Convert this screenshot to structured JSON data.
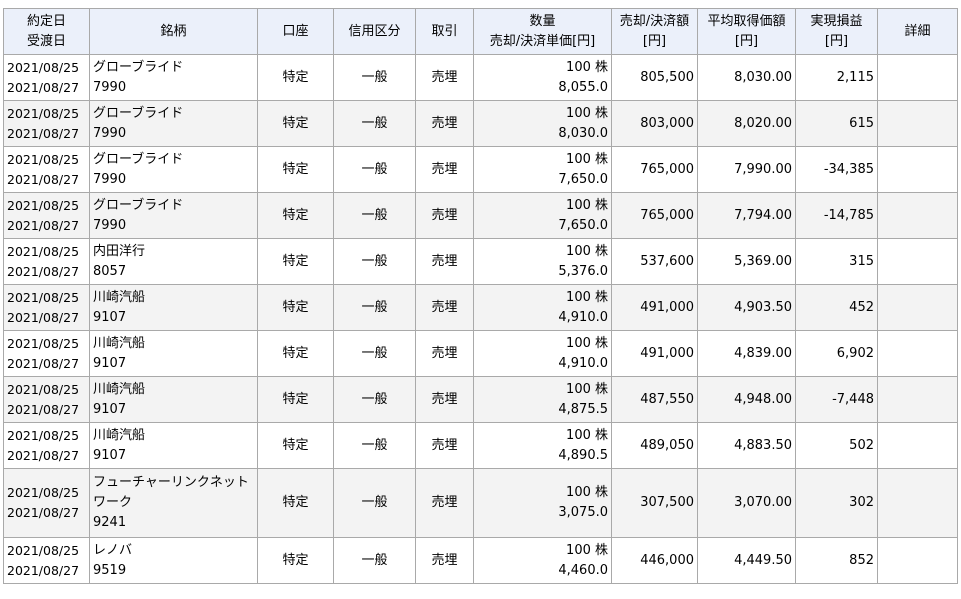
{
  "headers": {
    "date": [
      "約定日",
      "受渡日"
    ],
    "name": "銘柄",
    "account": "口座",
    "credit": "信用区分",
    "trade": "取引",
    "qty": [
      "数量",
      "売却/決済単価[円]"
    ],
    "amount": [
      "売却/決済額",
      "[円]"
    ],
    "avg": [
      "平均取得価額",
      "[円]"
    ],
    "pl": [
      "実現損益",
      "[円]"
    ],
    "detail": "詳細"
  },
  "rows": [
    {
      "trade_date": "2021/08/25",
      "settle_date": "2021/08/27",
      "name": "グローブライド",
      "code": "7990",
      "account": "特定",
      "credit": "一般",
      "trade": "売埋",
      "qty": "100 株",
      "unit_price": "8,055.0",
      "amount": "805,500",
      "avg_cost": "8,030.00",
      "pl": "2,115"
    },
    {
      "trade_date": "2021/08/25",
      "settle_date": "2021/08/27",
      "name": "グローブライド",
      "code": "7990",
      "account": "特定",
      "credit": "一般",
      "trade": "売埋",
      "qty": "100 株",
      "unit_price": "8,030.0",
      "amount": "803,000",
      "avg_cost": "8,020.00",
      "pl": "615"
    },
    {
      "trade_date": "2021/08/25",
      "settle_date": "2021/08/27",
      "name": "グローブライド",
      "code": "7990",
      "account": "特定",
      "credit": "一般",
      "trade": "売埋",
      "qty": "100 株",
      "unit_price": "7,650.0",
      "amount": "765,000",
      "avg_cost": "7,990.00",
      "pl": "-34,385"
    },
    {
      "trade_date": "2021/08/25",
      "settle_date": "2021/08/27",
      "name": "グローブライド",
      "code": "7990",
      "account": "特定",
      "credit": "一般",
      "trade": "売埋",
      "qty": "100 株",
      "unit_price": "7,650.0",
      "amount": "765,000",
      "avg_cost": "7,794.00",
      "pl": "-14,785"
    },
    {
      "trade_date": "2021/08/25",
      "settle_date": "2021/08/27",
      "name": "内田洋行",
      "code": "8057",
      "account": "特定",
      "credit": "一般",
      "trade": "売埋",
      "qty": "100 株",
      "unit_price": "5,376.0",
      "amount": "537,600",
      "avg_cost": "5,369.00",
      "pl": "315"
    },
    {
      "trade_date": "2021/08/25",
      "settle_date": "2021/08/27",
      "name": "川崎汽船",
      "code": "9107",
      "account": "特定",
      "credit": "一般",
      "trade": "売埋",
      "qty": "100 株",
      "unit_price": "4,910.0",
      "amount": "491,000",
      "avg_cost": "4,903.50",
      "pl": "452"
    },
    {
      "trade_date": "2021/08/25",
      "settle_date": "2021/08/27",
      "name": "川崎汽船",
      "code": "9107",
      "account": "特定",
      "credit": "一般",
      "trade": "売埋",
      "qty": "100 株",
      "unit_price": "4,910.0",
      "amount": "491,000",
      "avg_cost": "4,839.00",
      "pl": "6,902"
    },
    {
      "trade_date": "2021/08/25",
      "settle_date": "2021/08/27",
      "name": "川崎汽船",
      "code": "9107",
      "account": "特定",
      "credit": "一般",
      "trade": "売埋",
      "qty": "100 株",
      "unit_price": "4,875.5",
      "amount": "487,550",
      "avg_cost": "4,948.00",
      "pl": "-7,448"
    },
    {
      "trade_date": "2021/08/25",
      "settle_date": "2021/08/27",
      "name": "川崎汽船",
      "code": "9107",
      "account": "特定",
      "credit": "一般",
      "trade": "売埋",
      "qty": "100 株",
      "unit_price": "4,890.5",
      "amount": "489,050",
      "avg_cost": "4,883.50",
      "pl": "502"
    },
    {
      "trade_date": "2021/08/25",
      "settle_date": "2021/08/27",
      "name_line1": "フューチャーリンクネット",
      "name_line2": "ワーク",
      "code": "9241",
      "account": "特定",
      "credit": "一般",
      "trade": "売埋",
      "qty": "100 株",
      "unit_price": "3,075.0",
      "amount": "307,500",
      "avg_cost": "3,070.00",
      "pl": "302"
    },
    {
      "trade_date": "2021/08/25",
      "settle_date": "2021/08/27",
      "name": "レノバ",
      "code": "9519",
      "account": "特定",
      "credit": "一般",
      "trade": "売埋",
      "qty": "100 株",
      "unit_price": "4,460.0",
      "amount": "446,000",
      "avg_cost": "4,449.50",
      "pl": "852"
    }
  ]
}
